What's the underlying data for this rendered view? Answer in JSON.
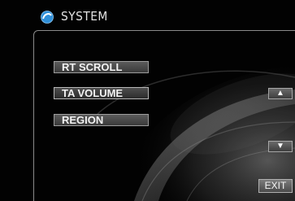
{
  "header": {
    "title": "SYSTEM",
    "icon": "system-logo-icon"
  },
  "menu": {
    "items": [
      {
        "label": "RT SCROLL"
      },
      {
        "label": "TA VOLUME"
      },
      {
        "label": "REGION"
      }
    ]
  },
  "controls": {
    "up": {
      "label": "▲",
      "icon": "arrow-up-icon"
    },
    "down": {
      "label": "▼",
      "icon": "arrow-down-icon"
    },
    "exit_label": "EXIT"
  },
  "colors": {
    "background": "#020202",
    "accent": "#2f8fd8",
    "button_border": "#9c9c9c"
  }
}
